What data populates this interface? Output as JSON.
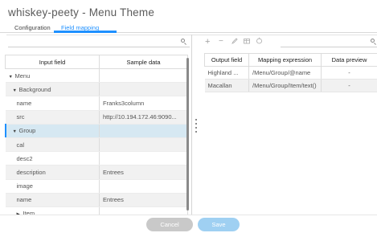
{
  "window": {
    "title": "whiskey-peety - Menu Theme"
  },
  "tabs": [
    {
      "label": "Configuration",
      "active": false
    },
    {
      "label": "Field mapping",
      "active": true
    }
  ],
  "left_panel": {
    "search": {
      "placeholder": ""
    },
    "columns": [
      "Input field",
      "Sample data"
    ],
    "rows": [
      {
        "field": "Menu",
        "sample": "",
        "level": 0,
        "expanded": true,
        "has_children": true,
        "shaded": false,
        "selected": false
      },
      {
        "field": "Background",
        "sample": "",
        "level": 1,
        "expanded": true,
        "has_children": true,
        "shaded": true,
        "selected": false
      },
      {
        "field": "name",
        "sample": "Franks3column",
        "level": 2,
        "expanded": false,
        "has_children": false,
        "shaded": false,
        "selected": false
      },
      {
        "field": "src",
        "sample": "http://10.194.172.46:9090...",
        "level": 2,
        "expanded": false,
        "has_children": false,
        "shaded": true,
        "selected": false
      },
      {
        "field": "Group",
        "sample": "",
        "level": 1,
        "expanded": true,
        "has_children": true,
        "shaded": false,
        "selected": true
      },
      {
        "field": "cal",
        "sample": "",
        "level": 2,
        "expanded": false,
        "has_children": false,
        "shaded": true,
        "selected": false
      },
      {
        "field": "desc2",
        "sample": "",
        "level": 2,
        "expanded": false,
        "has_children": false,
        "shaded": false,
        "selected": false
      },
      {
        "field": "description",
        "sample": "Entrees",
        "level": 2,
        "expanded": false,
        "has_children": false,
        "shaded": true,
        "selected": false
      },
      {
        "field": "image",
        "sample": "",
        "level": 2,
        "expanded": false,
        "has_children": false,
        "shaded": false,
        "selected": false
      },
      {
        "field": "name",
        "sample": "Entrees",
        "level": 2,
        "expanded": false,
        "has_children": false,
        "shaded": true,
        "selected": false
      },
      {
        "field": "Item",
        "sample": "",
        "level": 2,
        "expanded": false,
        "has_children": true,
        "shaded": false,
        "selected": false
      }
    ]
  },
  "right_panel": {
    "toolbar": {
      "add_icon": "plus-icon",
      "remove_icon": "minus-icon",
      "edit_icon": "pencil-icon",
      "map_icon": "table-icon",
      "refresh_icon": "refresh-icon"
    },
    "search": {
      "placeholder": ""
    },
    "columns": [
      "Output field",
      "Mapping expression",
      "Data preview"
    ],
    "rows": [
      {
        "output": "Highland ...",
        "expression": "/Menu/Group/@name",
        "preview": "-"
      },
      {
        "output": "Macallan",
        "expression": "/Menu/Group/Item/text()",
        "preview": "-"
      }
    ]
  },
  "footer": {
    "cancel_label": "Cancel",
    "save_label": "Save"
  },
  "colors": {
    "accent": "#1e90ff",
    "selected_row": "#d6e8f2",
    "save_button": "#9fd0f2",
    "cancel_button": "#c9c9c9"
  }
}
